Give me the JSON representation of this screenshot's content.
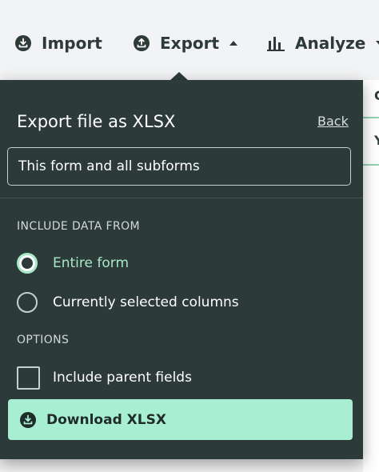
{
  "toolbar": {
    "import_label": "Import",
    "export_label": "Export",
    "analyze_label": "Analyze"
  },
  "background": {
    "char1": "C",
    "char2": "Y"
  },
  "panel": {
    "title": "Export file as XLSX",
    "back_label": "Back",
    "scope_value": "This form and all subforms",
    "include_section": "INCLUDE DATA FROM",
    "options_section": "OPTIONS",
    "radio_options": [
      {
        "label": "Entire form",
        "selected": true
      },
      {
        "label": "Currently selected columns",
        "selected": false
      }
    ],
    "include_parent_label": "Include parent fields",
    "include_parent_checked": false,
    "download_label": "Download XLSX"
  },
  "colors": {
    "panel_bg": "#2c3a39",
    "accent": "#a8eed2",
    "toolbar_bg": "#f2f3f4"
  }
}
